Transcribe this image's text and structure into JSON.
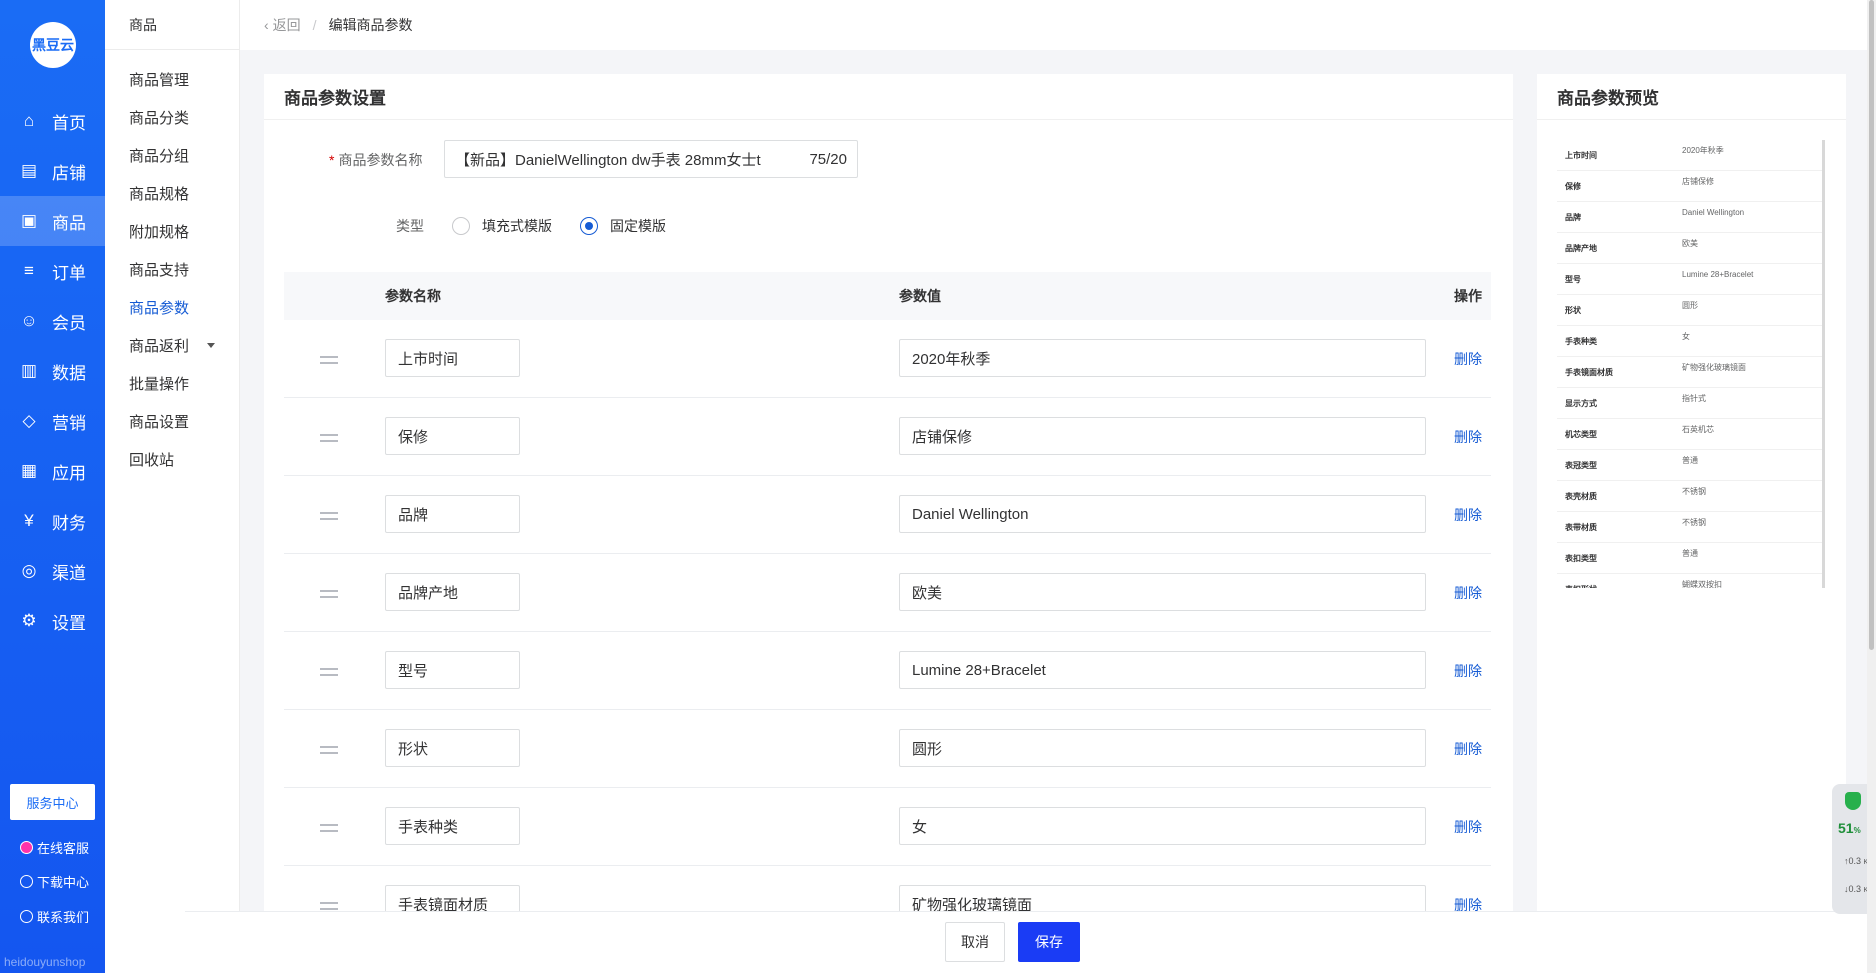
{
  "brand": {
    "logo_text": "黑豆云",
    "watermark": "heidouyunshop"
  },
  "main_nav": [
    {
      "label": "首页",
      "icon": "home-icon"
    },
    {
      "label": "店铺",
      "icon": "store-icon"
    },
    {
      "label": "商品",
      "icon": "goods-icon",
      "active": true
    },
    {
      "label": "订单",
      "icon": "order-icon"
    },
    {
      "label": "会员",
      "icon": "member-icon"
    },
    {
      "label": "数据",
      "icon": "data-icon"
    },
    {
      "label": "营销",
      "icon": "tag-icon"
    },
    {
      "label": "应用",
      "icon": "app-icon"
    },
    {
      "label": "财务",
      "icon": "finance-icon"
    },
    {
      "label": "渠道",
      "icon": "channel-icon"
    },
    {
      "label": "设置",
      "icon": "settings-icon"
    }
  ],
  "service": {
    "center_label": "服务中心",
    "online_label": "在线客服",
    "download_label": "下载中心",
    "contact_label": "联系我们"
  },
  "sub_nav": {
    "title": "商品",
    "items": [
      "商品管理",
      "商品分类",
      "商品分组",
      "商品规格",
      "附加规格",
      "商品支持",
      "商品参数",
      "商品返利",
      "批量操作",
      "商品设置",
      "回收站"
    ],
    "active": "商品参数"
  },
  "breadcrumb": {
    "back": "返回",
    "separator": "/",
    "current": "编辑商品参数"
  },
  "form": {
    "section_title": "商品参数设置",
    "name_label": "商品参数名称",
    "name_value": "【新品】DanielWellington dw手表 28mm女士t",
    "name_count": "75/20",
    "type_label": "类型",
    "type_options": [
      "填充式模版",
      "固定模版"
    ],
    "type_selected": "固定模版"
  },
  "table": {
    "headers": {
      "name": "参数名称",
      "value": "参数值",
      "action": "操作"
    },
    "delete_label": "删除",
    "rows": [
      {
        "name": "上市时间",
        "value": "2020年秋季"
      },
      {
        "name": "保修",
        "value": "店铺保修"
      },
      {
        "name": "品牌",
        "value": "Daniel Wellington"
      },
      {
        "name": "品牌产地",
        "value": "欧美"
      },
      {
        "name": "型号",
        "value": "Lumine 28+Bracelet"
      },
      {
        "name": "形状",
        "value": "圆形"
      },
      {
        "name": "手表种类",
        "value": "女"
      },
      {
        "name": "手表镜面材质",
        "value": "矿物强化玻璃镜面"
      }
    ]
  },
  "preview": {
    "title": "商品参数预览",
    "rows": [
      {
        "name": "上市时间",
        "value": "2020年秋季"
      },
      {
        "name": "保修",
        "value": "店铺保修"
      },
      {
        "name": "品牌",
        "value": "Daniel Wellington"
      },
      {
        "name": "品牌产地",
        "value": "欧美"
      },
      {
        "name": "型号",
        "value": "Lumine 28+Bracelet"
      },
      {
        "name": "形状",
        "value": "圆形"
      },
      {
        "name": "手表种类",
        "value": "女"
      },
      {
        "name": "手表镜面材质",
        "value": "矿物强化玻璃镜面"
      },
      {
        "name": "显示方式",
        "value": "指针式"
      },
      {
        "name": "机芯类型",
        "value": "石英机芯"
      },
      {
        "name": "表冠类型",
        "value": "普通"
      },
      {
        "name": "表壳材质",
        "value": "不锈钢"
      },
      {
        "name": "表带材质",
        "value": "不锈钢"
      },
      {
        "name": "表扣类型",
        "value": "普通"
      },
      {
        "name": "表扣形状",
        "value": "蝴蝶双按扣"
      }
    ]
  },
  "actions": {
    "cancel": "取消",
    "save": "保存"
  },
  "widget": {
    "percent": "51",
    "percent_unit": "%",
    "up": "0.3",
    "down": "0.3",
    "unit": "K/s"
  },
  "colors": {
    "primary": "#1a6cf5",
    "link": "#155bd4",
    "save": "#1a3cf5"
  }
}
